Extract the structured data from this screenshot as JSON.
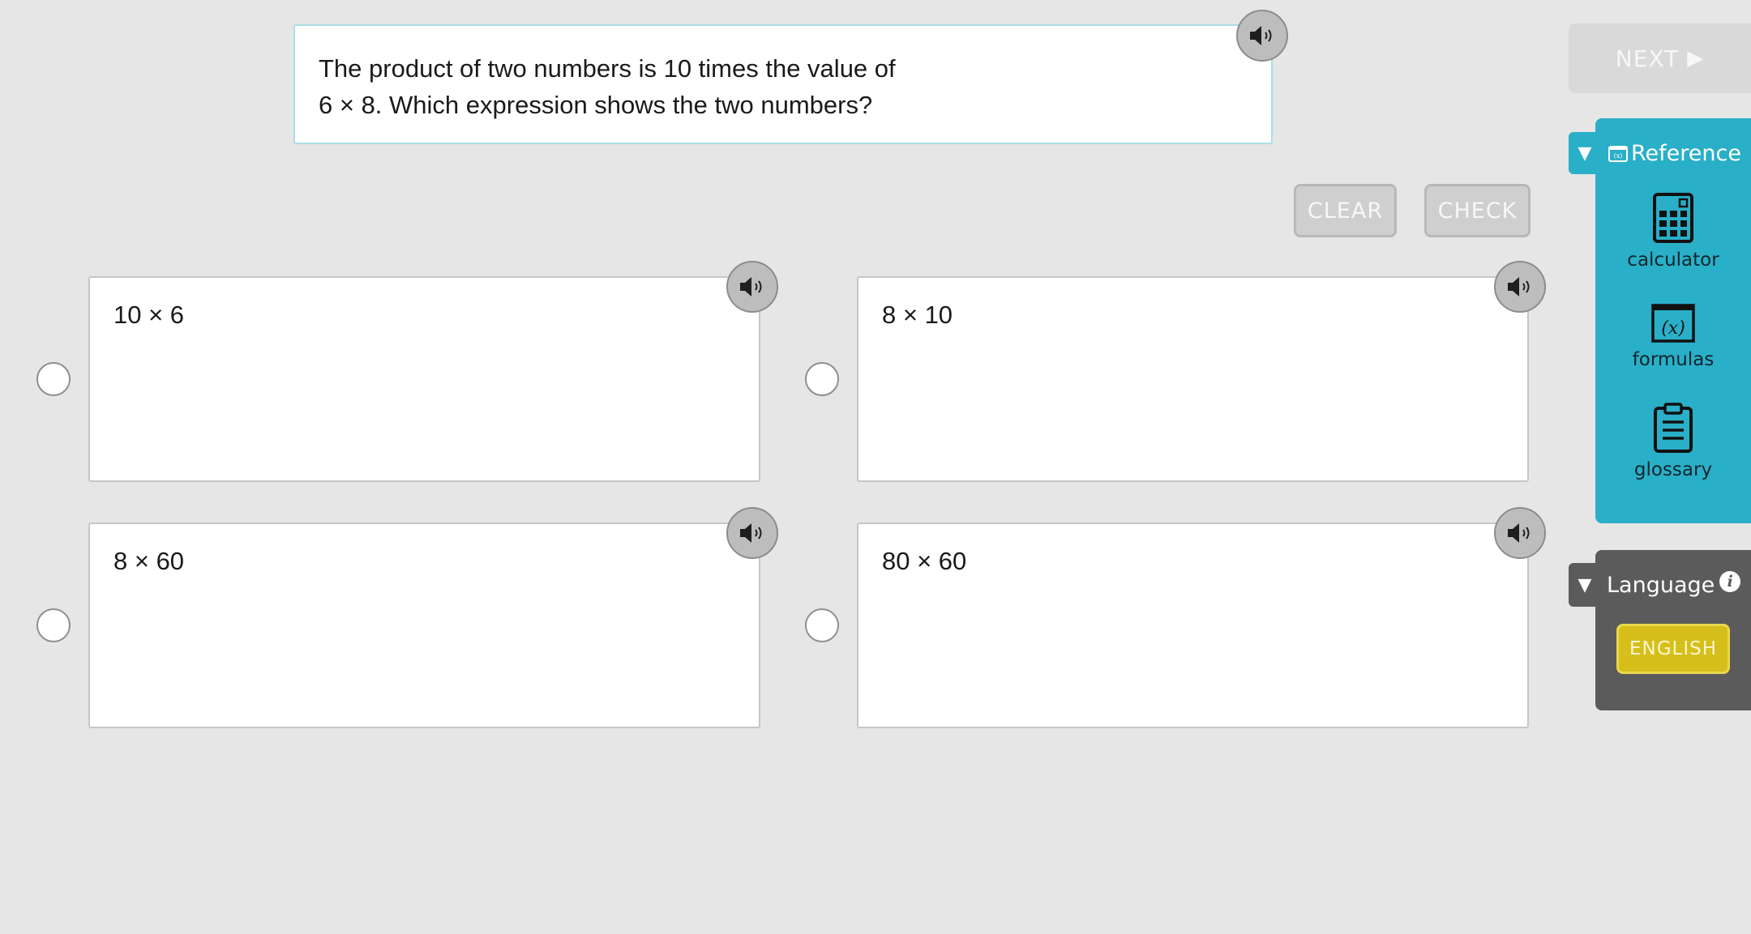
{
  "question": {
    "text_line1": "The product of two numbers is 10 times the value of",
    "text_line2": "6 × 8. Which expression shows the two numbers?"
  },
  "toolbar": {
    "clear_label": "CLEAR",
    "check_label": "CHECK",
    "next_label": "NEXT",
    "next_icon": "play-arrow-icon"
  },
  "options": [
    {
      "label": "10 × 6",
      "selected": false
    },
    {
      "label": "8 × 10",
      "selected": false
    },
    {
      "label": "8 × 60",
      "selected": false
    },
    {
      "label": "80 × 60",
      "selected": false
    }
  ],
  "reference": {
    "title": "Reference",
    "tools": [
      {
        "label": "calculator",
        "icon": "calculator-icon"
      },
      {
        "label": "formulas",
        "icon": "formulas-icon"
      },
      {
        "label": "glossary",
        "icon": "clipboard-icon"
      }
    ]
  },
  "language": {
    "title": "Language",
    "selected": "ENGLISH"
  },
  "colors": {
    "reference_panel": "#2aafc8",
    "language_panel": "#5b5b5b",
    "language_button": "#d6bf1a",
    "background": "#e6e6e6"
  }
}
